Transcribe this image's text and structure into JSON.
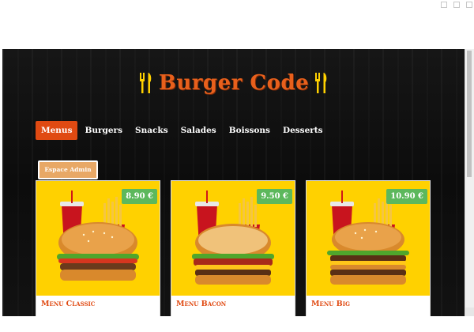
{
  "site": {
    "name": "Burger Code"
  },
  "nav": {
    "items": [
      {
        "label": "Menus",
        "active": true
      },
      {
        "label": "Burgers",
        "active": false
      },
      {
        "label": "Snacks",
        "active": false
      },
      {
        "label": "Salades",
        "active": false
      },
      {
        "label": "Boissons",
        "active": false
      },
      {
        "label": "Desserts",
        "active": false
      }
    ]
  },
  "admin": {
    "label": "Espace Admin"
  },
  "products": [
    {
      "name": "Menu Classic",
      "price": "8.90 €"
    },
    {
      "name": "Menu Bacon",
      "price": "9.50 €"
    },
    {
      "name": "Menu Big",
      "price": "10.90 €"
    }
  ],
  "colors": {
    "brand": "#e8601c",
    "nav_active": "#e04a12",
    "price_badge": "#5cb85c",
    "card_image_bg": "#ffd100",
    "admin_button": "#e8a866"
  },
  "icons": [
    "fork-knife-icon"
  ]
}
